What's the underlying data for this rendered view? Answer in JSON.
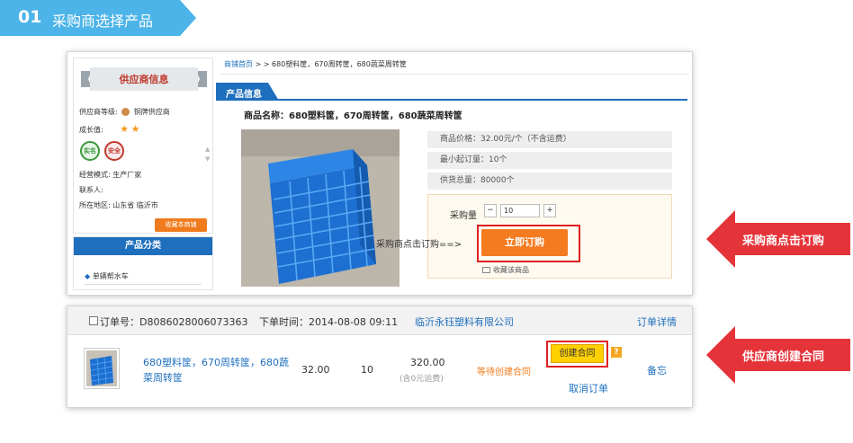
{
  "step": {
    "number": "01",
    "title": "采购商选择产品"
  },
  "supplier": {
    "header": "供应商信息",
    "level_label": "供应商等级:",
    "level_value": "铜牌供应商",
    "growth_label": "成长值:",
    "badge_verified": "实名",
    "badge_secure": "安全",
    "mode_label": "经营模式:",
    "mode_value": "生产厂家",
    "contact_label": "联系人:",
    "location_label": "所在地区:",
    "location_value": "山东省 临沂市",
    "favorite_shop_button": "收藏本商铺"
  },
  "category": {
    "header": "产品分类",
    "item": "单辆帮水车"
  },
  "breadcrumb": {
    "home": "商铺首页",
    "sep": " > > ",
    "current": "680塑料筐，670周转筐，680蔬菜周转筐"
  },
  "product_tab": "产品信息",
  "product": {
    "name_label": "商品名称：",
    "name": "680塑料筐，670周转筐，680蔬菜周转筐",
    "price": "商品价格：32.00元/个（不含运费）",
    "moq": "最小起订量：10个",
    "supply": "供货总量：80000个",
    "qty_label": "采购量",
    "qty_minus": "−",
    "qty_value": "10",
    "qty_plus": "+",
    "buy_button": "立即订购",
    "favorite_product": "收藏该商品"
  },
  "inline_annotation": "采购商点击订购==>",
  "order": {
    "order_no": "订单号：D8086028006073363",
    "order_time": "下单时间：2014-08-08 09:11",
    "company": "临沂永钰塑料有限公司",
    "detail_link": "订单详情",
    "product_name": "680塑料筐，670周转筐，680蔬菜周转筐",
    "unit_price": "32.00",
    "quantity": "10",
    "total": "320.00",
    "shipping_note": "(含0元运费)",
    "status": "等待创建合同",
    "create_contract_button": "创建合同",
    "help": "?",
    "cancel_link": "取消订单",
    "note_link": "备忘"
  },
  "callouts": {
    "buyer": "采购商点击订购",
    "supplier": "供应商创建合同"
  },
  "colors": {
    "accent_blue": "#1e6fbd",
    "banner_blue": "#4cb4e8",
    "orange": "#f47b20",
    "red": "#e5333a",
    "yellow": "#ffd000"
  }
}
